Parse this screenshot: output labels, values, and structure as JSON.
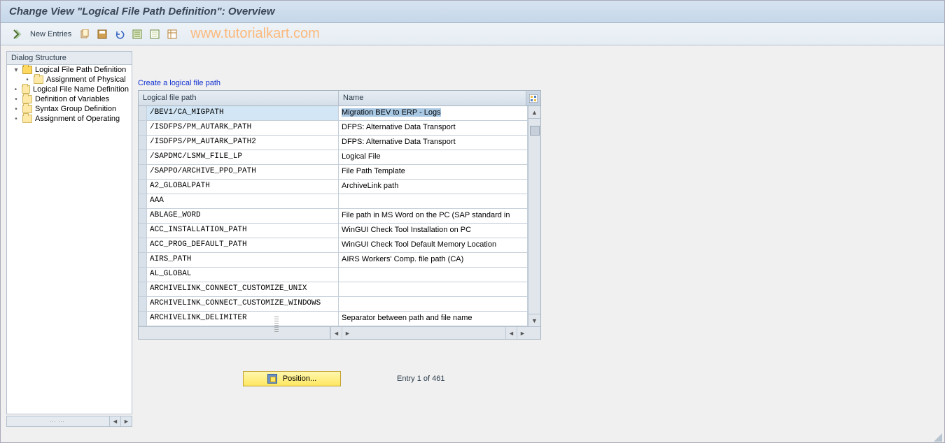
{
  "title": "Change View \"Logical File Path Definition\": Overview",
  "toolbar": {
    "new_entries": "New Entries"
  },
  "watermark": "www.tutorialkart.com",
  "sidebar": {
    "header": "Dialog Structure",
    "items": [
      {
        "label": "Logical File Path Definition",
        "icon": "open",
        "level": 0,
        "toggle": "▾"
      },
      {
        "label": "Assignment of Physical",
        "icon": "closed",
        "level": 1,
        "toggle": "•"
      },
      {
        "label": "Logical File Name Definition",
        "icon": "closed",
        "level": 0,
        "toggle": "•"
      },
      {
        "label": "Definition of Variables",
        "icon": "closed",
        "level": 0,
        "toggle": "•"
      },
      {
        "label": "Syntax Group Definition",
        "icon": "closed",
        "level": 0,
        "toggle": "•"
      },
      {
        "label": "Assignment of Operating",
        "icon": "closed",
        "level": 0,
        "toggle": "•"
      }
    ]
  },
  "main": {
    "link": "Create a logical file path",
    "columns": {
      "path": "Logical file path",
      "name": "Name"
    },
    "rows": [
      {
        "path": "/BEV1/CA_MIGPATH",
        "name": "Migration BEV to ERP - Logs",
        "selected": true
      },
      {
        "path": "/ISDFPS/PM_AUTARK_PATH",
        "name": "DFPS: Alternative Data Transport"
      },
      {
        "path": "/ISDFPS/PM_AUTARK_PATH2",
        "name": "DFPS: Alternative Data Transport"
      },
      {
        "path": "/SAPDMC/LSMW_FILE_LP",
        "name": "Logical File"
      },
      {
        "path": "/SAPPO/ARCHIVE_PPO_PATH",
        "name": "File Path Template"
      },
      {
        "path": "A2_GLOBALPATH",
        "name": "ArchiveLink path"
      },
      {
        "path": "AAA",
        "name": ""
      },
      {
        "path": "ABLAGE_WORD",
        "name": "File path in MS Word on the PC (SAP standard in"
      },
      {
        "path": "ACC_INSTALLATION_PATH",
        "name": "WinGUI Check Tool Installation on PC"
      },
      {
        "path": "ACC_PROG_DEFAULT_PATH",
        "name": "WinGUI Check Tool Default Memory Location"
      },
      {
        "path": "AIRS_PATH",
        "name": "AIRS Workers' Comp. file path (CA)"
      },
      {
        "path": "AL_GLOBAL",
        "name": ""
      },
      {
        "path": "ARCHIVELINK_CONNECT_CUSTOMIZE_UNIX",
        "name": ""
      },
      {
        "path": "ARCHIVELINK_CONNECT_CUSTOMIZE_WINDOWS",
        "name": ""
      },
      {
        "path": "ARCHIVELINK_DELIMITER",
        "name": "Separator between path and file name"
      }
    ],
    "position_button": "Position...",
    "entry_status": "Entry 1 of 461"
  }
}
